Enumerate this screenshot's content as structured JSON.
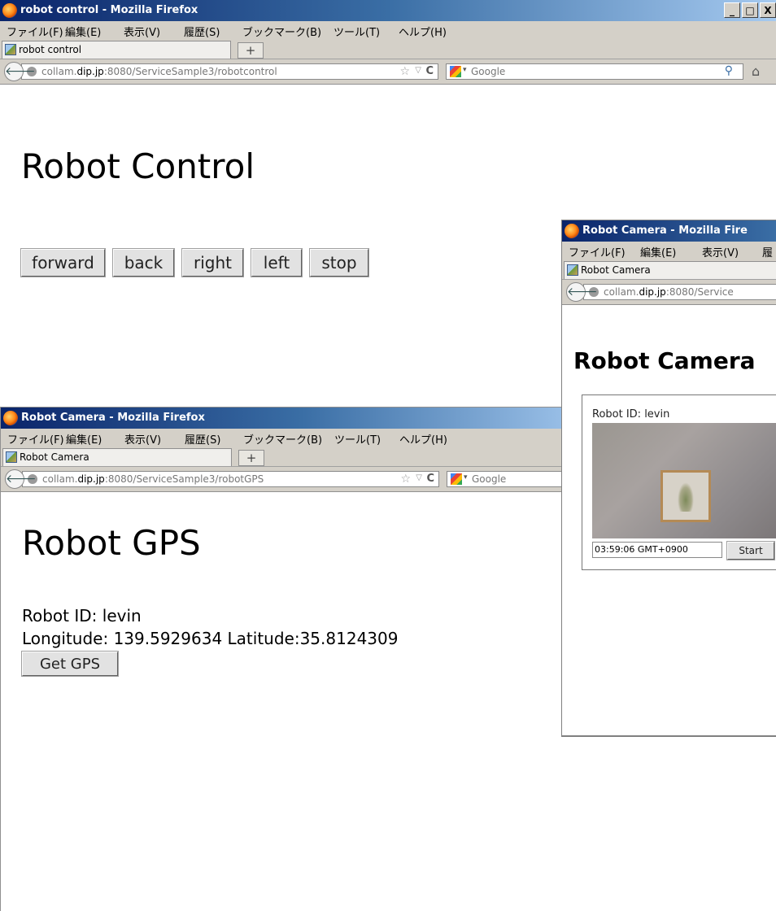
{
  "control_window": {
    "title": "robot control - Mozilla Firefox",
    "menu": [
      "ファイル(F)",
      "編集(E)",
      "表示(V)",
      "履歴(S)",
      "ブックマーク(B)",
      "ツール(T)",
      "ヘルプ(H)"
    ],
    "tab_label": "robot control",
    "new_tab": "+",
    "url_prefix": "collam.",
    "url_domain": "dip.jp",
    "url_rest": ":8080/ServiceSample3/robotcontrol",
    "search_placeholder": "Google",
    "heading": "Robot Control",
    "buttons": [
      "forward",
      "back",
      "right",
      "left",
      "stop"
    ],
    "window_controls": [
      "_",
      "□",
      "X"
    ]
  },
  "gps_window": {
    "title": "Robot Camera - Mozilla Firefox",
    "menu": [
      "ファイル(F)",
      "編集(E)",
      "表示(V)",
      "履歴(S)",
      "ブックマーク(B)",
      "ツール(T)",
      "ヘルプ(H)"
    ],
    "tab_label": "Robot Camera",
    "new_tab": "+",
    "url_prefix": "collam.",
    "url_domain": "dip.jp",
    "url_rest": ":8080/ServiceSample3/robotGPS",
    "search_placeholder": "Google",
    "heading": "Robot GPS",
    "robot_id": "Robot ID: levin",
    "coords": "Longitude: 139.5929634 Latitude:35.8124309",
    "button": "Get GPS"
  },
  "camera_window": {
    "title": "Robot Camera - Mozilla Fire",
    "menu": [
      "ファイル(F)",
      "編集(E)",
      "表示(V)",
      "履"
    ],
    "tab_label": "Robot Camera",
    "url_prefix": "collam.",
    "url_domain": "dip.jp",
    "url_rest": ":8080/Service",
    "heading": "Robot Camera",
    "robot_id": "Robot ID: levin",
    "timestamp": "03:59:06 GMT+0900",
    "start_button": "Start"
  }
}
